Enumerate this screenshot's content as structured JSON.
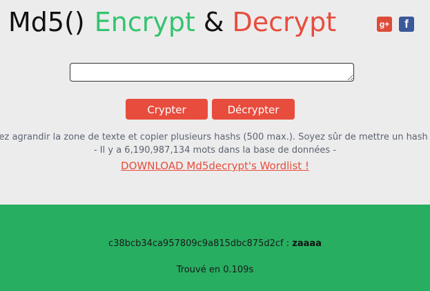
{
  "header": {
    "title_part1": "Md5()",
    "title_part2": "Encrypt",
    "title_part3": "&",
    "title_part4": "Decrypt",
    "colors": {
      "dark": "#111111",
      "green": "#34c46f",
      "red": "#e74c3c"
    },
    "social": [
      {
        "icon": "google-plus-icon",
        "label": "g+"
      },
      {
        "icon": "facebook-icon",
        "label": "f"
      }
    ]
  },
  "form": {
    "textarea_value": "",
    "crypt_label": "Crypter",
    "decrypt_label": "Décrypter"
  },
  "info": {
    "line1": "vez agrandir la zone de texte et copier plusieurs hashs (500 max.). Soyez sûr de mettre un hash p",
    "line2": "- Il y a 6,190,987,134 mots dans la base de données -",
    "download_link": "DOWNLOAD Md5decrypt's Wordlist !"
  },
  "result": {
    "hash": "c38bcb34ca957809c9a815dbc875d2cf",
    "separator": " : ",
    "plaintext": "zaaaa",
    "time_text": "Trouvé en 0.109s",
    "background": "#27ae60"
  }
}
